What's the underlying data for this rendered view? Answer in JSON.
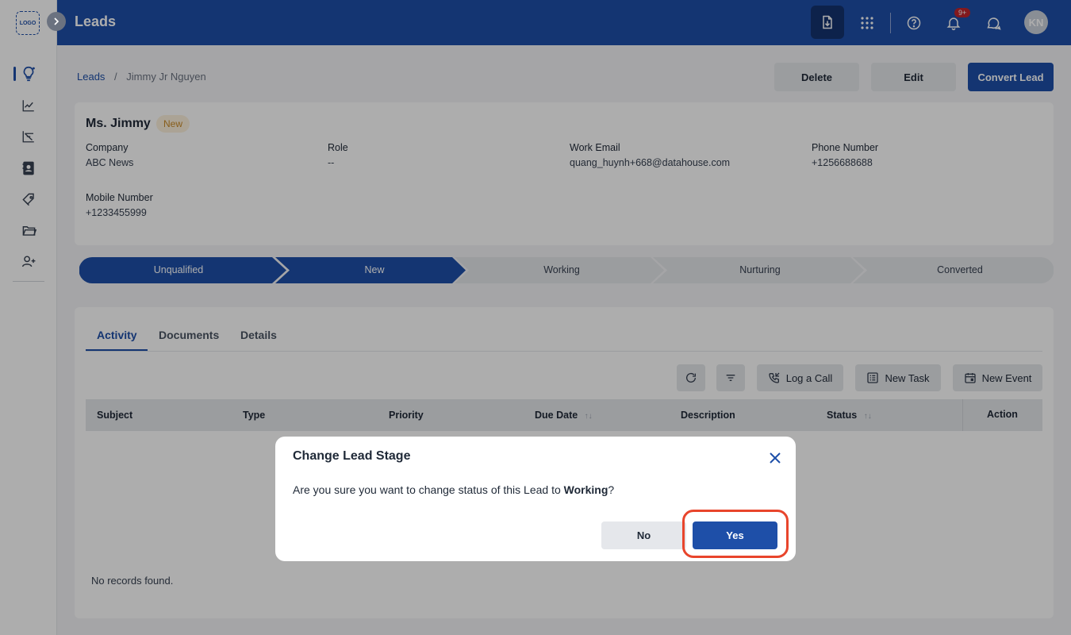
{
  "sidebar": {
    "logo_text": "LOGO",
    "items": [
      {
        "icon": "lightbulb-icon"
      },
      {
        "icon": "trend-chart-icon"
      },
      {
        "icon": "funnel-chart-icon"
      },
      {
        "icon": "contact-card-icon"
      },
      {
        "icon": "tag-icon"
      },
      {
        "icon": "folder-icon"
      },
      {
        "icon": "add-user-icon"
      }
    ]
  },
  "header": {
    "title": "Leads",
    "notification_count": "9+",
    "avatar_initials": "KN",
    "bg_color": "#1e4fa8"
  },
  "breadcrumb": {
    "root": "Leads",
    "separator": "/",
    "current": "Jimmy Jr Nguyen"
  },
  "actions": {
    "delete": "Delete",
    "edit": "Edit",
    "convert": "Convert Lead"
  },
  "lead": {
    "name": "Ms. Jimmy",
    "status": "New",
    "fields": {
      "company_label": "Company",
      "company": "ABC News",
      "role_label": "Role",
      "role": "--",
      "email_label": "Work Email",
      "email": "quang_huynh+668@datahouse.com",
      "phone_label": "Phone Number",
      "phone": "+1256688688",
      "mobile_label": "Mobile Number",
      "mobile": "+1233455999"
    }
  },
  "stages": [
    "Unqualified",
    "New",
    "Working",
    "Nurturing",
    "Converted"
  ],
  "tabs": [
    "Activity",
    "Documents",
    "Details"
  ],
  "toolbar": {
    "log_call": "Log a Call",
    "new_task": "New Task",
    "new_event": "New Event"
  },
  "table": {
    "columns": [
      "Subject",
      "Type",
      "Priority",
      "Due Date",
      "Description",
      "Status",
      "Action"
    ],
    "empty_text": "No records found."
  },
  "modal": {
    "title": "Change Lead Stage",
    "message_prefix": "Are you sure you want to change status of this Lead to ",
    "message_stage": "Working",
    "message_suffix": "?",
    "no_label": "No",
    "yes_label": "Yes"
  }
}
